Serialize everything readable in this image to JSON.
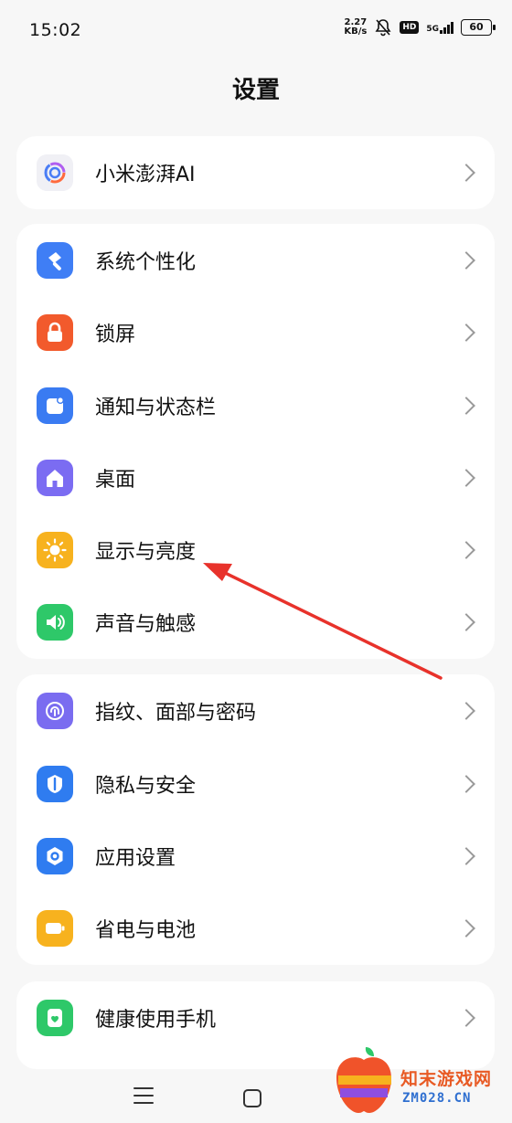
{
  "status_bar": {
    "time": "15:02",
    "net_speed_value": "2.27",
    "net_speed_unit": "KB/s",
    "hd": "HD",
    "network": "5G",
    "battery": "60"
  },
  "page_title": "设置",
  "groups": [
    {
      "items": [
        {
          "label": "小米澎湃AI",
          "icon": "hyperos-ai-icon",
          "color": "#f0f0f5"
        }
      ]
    },
    {
      "items": [
        {
          "label": "系统个性化",
          "icon": "personalization-icon",
          "color": "#3f7ef5"
        },
        {
          "label": "锁屏",
          "icon": "lock-icon",
          "color": "#f25a2c"
        },
        {
          "label": "通知与状态栏",
          "icon": "notification-icon",
          "color": "#3a7bf2"
        },
        {
          "label": "桌面",
          "icon": "home-icon",
          "color": "#7b6cf2"
        },
        {
          "label": "显示与亮度",
          "icon": "brightness-icon",
          "color": "#f7b21e"
        },
        {
          "label": "声音与触感",
          "icon": "sound-icon",
          "color": "#2ec869"
        }
      ]
    },
    {
      "items": [
        {
          "label": "指纹、面部与密码",
          "icon": "fingerprint-icon",
          "color": "#7a6cf0"
        },
        {
          "label": "隐私与安全",
          "icon": "privacy-shield-icon",
          "color": "#2f7cf0"
        },
        {
          "label": "应用设置",
          "icon": "app-settings-icon",
          "color": "#2f7cf0"
        },
        {
          "label": "省电与电池",
          "icon": "battery-icon",
          "color": "#f7b21e"
        }
      ]
    },
    {
      "items": [
        {
          "label": "健康使用手机",
          "icon": "digital-wellbeing-icon",
          "color": "#2ec869"
        }
      ]
    }
  ],
  "watermark": {
    "name": "知末游戏网",
    "domain": "ZM028.CN"
  },
  "annotation_color": "#e8322b"
}
